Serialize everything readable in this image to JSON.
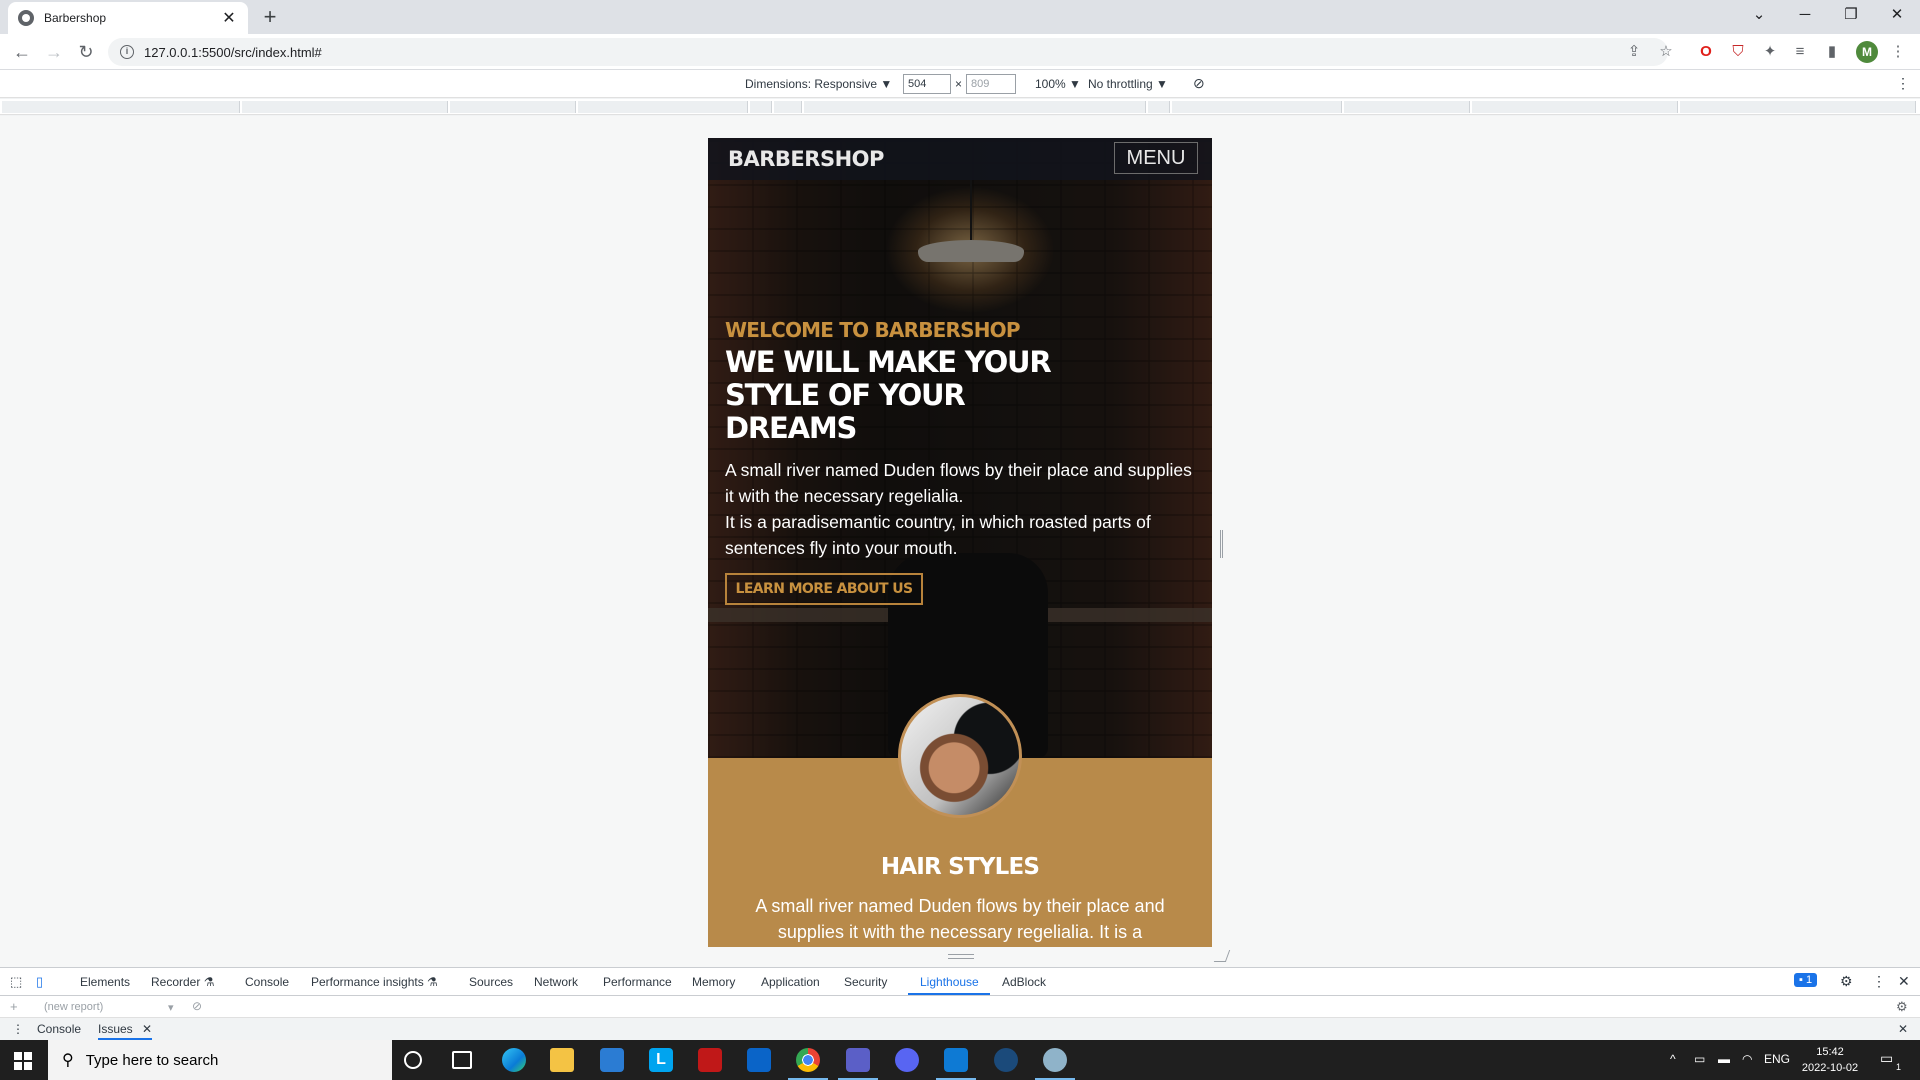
{
  "browser": {
    "tab_title": "Barbershop",
    "tab_close": "✕",
    "new_tab": "+",
    "url": "127.0.0.1:5500/src/index.html#",
    "avatar_initial": "M"
  },
  "device_toolbar": {
    "dimensions_label": "Dimensions: Responsive ▼",
    "width": "504",
    "times": "×",
    "height": "809",
    "zoom": "100% ▼",
    "throttling": "No throttling ▼"
  },
  "site": {
    "brand": "BARBERSHOP",
    "menu": "MENU",
    "welcome": "WELCOME TO BARBERSHOP",
    "headline": "WE WILL MAKE YOUR STYLE OF YOUR DREAMS",
    "paragraph_1": "A small river named Duden flows by their place and supplies it with the necessary regelialia.",
    "paragraph_2": "It is a paradisemantic country, in which roasted parts of sentences fly into your mouth.",
    "cta": "LEARN MORE ABOUT US",
    "section_title": "HAIR STYLES",
    "section_text": "A small river named Duden flows by their place and supplies it with the necessary regelialia. It is a"
  },
  "devtools": {
    "tabs": [
      "Elements",
      "Recorder ⚗",
      "Console",
      "Performance insights ⚗",
      "Sources",
      "Network",
      "Performance",
      "Memory",
      "Application",
      "Security",
      "Lighthouse",
      "AdBlock"
    ],
    "active_tab": "Lighthouse",
    "issues_count": "1",
    "report_placeholder": "(new report)",
    "drawer_tabs": [
      "Console",
      "Issues"
    ]
  },
  "taskbar": {
    "search_placeholder": "Type here to search",
    "language": "ENG",
    "time": "15:42",
    "date": "2022-10-02",
    "notification_count": "1"
  },
  "colors": {
    "accent_gold": "#c8913f",
    "section_bg": "#b88a4a",
    "devtools_active": "#1a73e8"
  }
}
